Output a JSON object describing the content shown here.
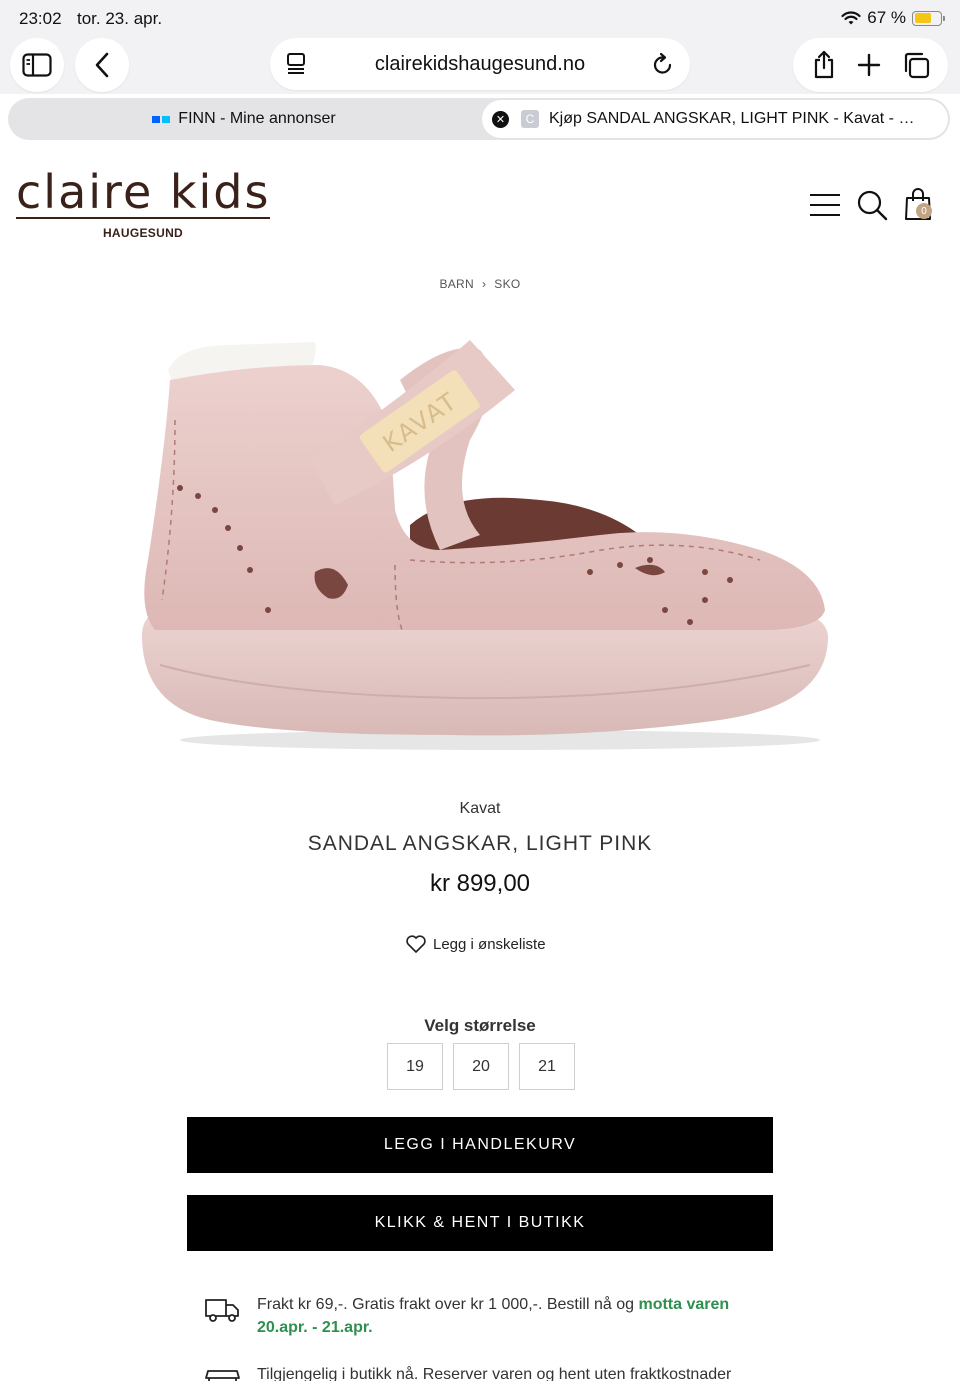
{
  "status_bar": {
    "time": "23:02",
    "date": "tor. 23. apr.",
    "battery": "67 %"
  },
  "browser": {
    "url": "clairekidshaugesund.no",
    "tabs": [
      {
        "label": "FINN - Mine annonser"
      },
      {
        "label": "Kjøp SANDAL ANGSKAR, LIGHT PINK - Kavat - B...",
        "favicon_letter": "C"
      }
    ]
  },
  "site": {
    "logo_main": "claire kids",
    "logo_sub": "HAUGESUND",
    "cart_count": "0"
  },
  "breadcrumb": {
    "items": [
      "BARN",
      "SKO"
    ],
    "separator": "›"
  },
  "product": {
    "brand": "Kavat",
    "name": "SANDAL ANGSKAR, LIGHT PINK",
    "price": "kr 899,00",
    "wishlist_label": "Legg i ønskeliste",
    "label_text": "KAVAT",
    "color": "#e8c9c6"
  },
  "size_selector": {
    "title": "Velg størrelse",
    "sizes": [
      "19",
      "20",
      "21"
    ]
  },
  "actions": {
    "add_to_cart": "LEGG I HANDLEKURV",
    "click_collect": "KLIKK & HENT I BUTIKK"
  },
  "shipping": {
    "text": "Frakt kr 69,-. Gratis frakt over kr 1 000,-. Bestill nå og",
    "highlight_1": "motta varen",
    "highlight_2": "20.apr. - 21.apr.",
    "store_text": "Tilgjengelig i butikk nå. Reserver varen og hent uten fraktkostnader"
  },
  "colors": {
    "brand_brown": "#3a2119",
    "highlight_green": "#2f8f4f",
    "button_black": "#000000"
  }
}
